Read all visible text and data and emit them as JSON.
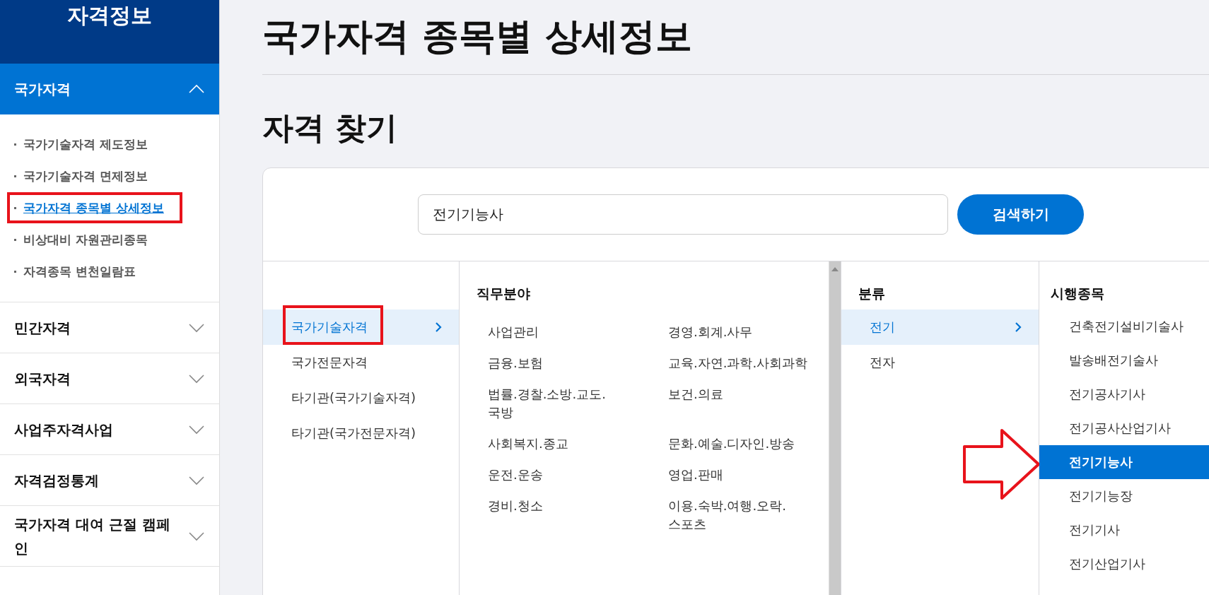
{
  "sidebar": {
    "title": "자격정보",
    "sections": [
      {
        "label": "국가자격",
        "expanded": true,
        "items": [
          {
            "label": "국가기술자격 제도정보",
            "selected": false,
            "highlighted": false
          },
          {
            "label": "국가기술자격 면제정보",
            "selected": false,
            "highlighted": false
          },
          {
            "label": "국가자격 종목별 상세정보",
            "selected": true,
            "highlighted": true
          },
          {
            "label": "비상대비 자원관리종목",
            "selected": false,
            "highlighted": false
          },
          {
            "label": "자격종목 변천일람표",
            "selected": false,
            "highlighted": false
          }
        ]
      },
      {
        "label": "민간자격",
        "expanded": false
      },
      {
        "label": "외국자격",
        "expanded": false
      },
      {
        "label": "사업주자격사업",
        "expanded": false
      },
      {
        "label": "자격검정통계",
        "expanded": false
      },
      {
        "label": "국가자격 대여 근절 캠페인",
        "expanded": false
      }
    ]
  },
  "page": {
    "title": "국가자격 종목별 상세정보",
    "section_title": "자격 찾기"
  },
  "search": {
    "value": "전기기능사",
    "button": "검색하기"
  },
  "categories": [
    {
      "label": "국가기술자격",
      "selected": true,
      "highlighted": true
    },
    {
      "label": "국가전문자격",
      "selected": false,
      "highlighted": false
    },
    {
      "label": "타기관(국가기술자격)",
      "selected": false,
      "highlighted": false
    },
    {
      "label": "타기관(국가전문자격)",
      "selected": false,
      "highlighted": false
    }
  ],
  "fields": {
    "heading": "직무분야",
    "items": [
      "사업관리",
      "경영.회계.사무",
      "금융.보험",
      "교육.자연.과학.사회과학",
      "법률.경찰.소방.교도.국방",
      "보건.의료",
      "사회복지.종교",
      "문화.예술.디자인.방송",
      "운전.운송",
      "영업.판매",
      "경비.청소",
      "이용.숙박.여행.오락.스포츠"
    ]
  },
  "classes": {
    "heading": "분류",
    "items": [
      {
        "label": "전기",
        "selected": true
      },
      {
        "label": "전자",
        "selected": false
      }
    ]
  },
  "exams": {
    "heading": "시행종목",
    "items": [
      {
        "label": "건축전기설비기술사",
        "selected": false,
        "pointed": false
      },
      {
        "label": "발송배전기술사",
        "selected": false,
        "pointed": false
      },
      {
        "label": "전기공사기사",
        "selected": false,
        "pointed": false
      },
      {
        "label": "전기공사산업기사",
        "selected": false,
        "pointed": false
      },
      {
        "label": "전기기능사",
        "selected": true,
        "pointed": true
      },
      {
        "label": "전기기능장",
        "selected": false,
        "pointed": false
      },
      {
        "label": "전기기사",
        "selected": false,
        "pointed": false
      },
      {
        "label": "전기산업기사",
        "selected": false,
        "pointed": false
      }
    ]
  }
}
